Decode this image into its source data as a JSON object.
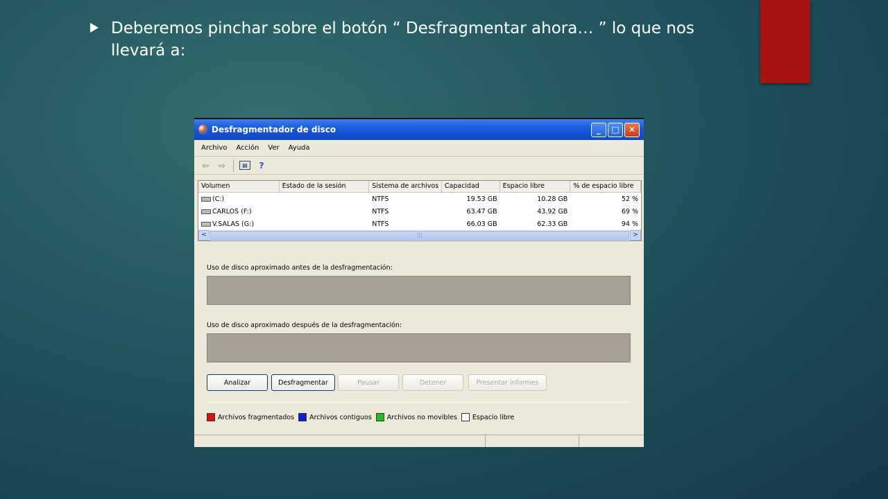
{
  "slide": {
    "text": " Deberemos pinchar sobre el botón “ Desfragmentar ahora… ” lo que nos llevará a:"
  },
  "window": {
    "title": "Desfragmentador de disco",
    "menu": [
      "Archivo",
      "Acción",
      "Ver",
      "Ayuda"
    ],
    "columns": [
      "Volumen",
      "Estado de la sesión",
      "Sistema de archivos",
      "Capacidad",
      "Espacio libre",
      "% de espacio libre"
    ],
    "rows": [
      {
        "volume": "(C:)",
        "status": "",
        "fs": "NTFS",
        "capacity": "19.53 GB",
        "free": "10.28 GB",
        "pct": "52 %"
      },
      {
        "volume": "CARLOS (F:)",
        "status": "",
        "fs": "NTFS",
        "capacity": "63.47 GB",
        "free": "43.92 GB",
        "pct": "69 %"
      },
      {
        "volume": "V.SALAS (G:)",
        "status": "",
        "fs": "NTFS",
        "capacity": "66.03 GB",
        "free": "62.33 GB",
        "pct": "94 %"
      }
    ],
    "before_label": "Uso de disco aproximado antes de la desfragmentación:",
    "after_label": "Uso de disco aproximado después de la desfragmentación:",
    "buttons": {
      "analyze": "Analizar",
      "defrag": "Desfragmentar",
      "pause": "Pausar",
      "stop": "Detener",
      "report": "Presentar informes"
    },
    "legend": [
      {
        "label": "Archivos fragmentados",
        "color": "#e01010"
      },
      {
        "label": "Archivos contiguos",
        "color": "#1020d0"
      },
      {
        "label": "Archivos no movibles",
        "color": "#20c020"
      },
      {
        "label": "Espacio libre",
        "color": "#ffffff"
      }
    ]
  }
}
